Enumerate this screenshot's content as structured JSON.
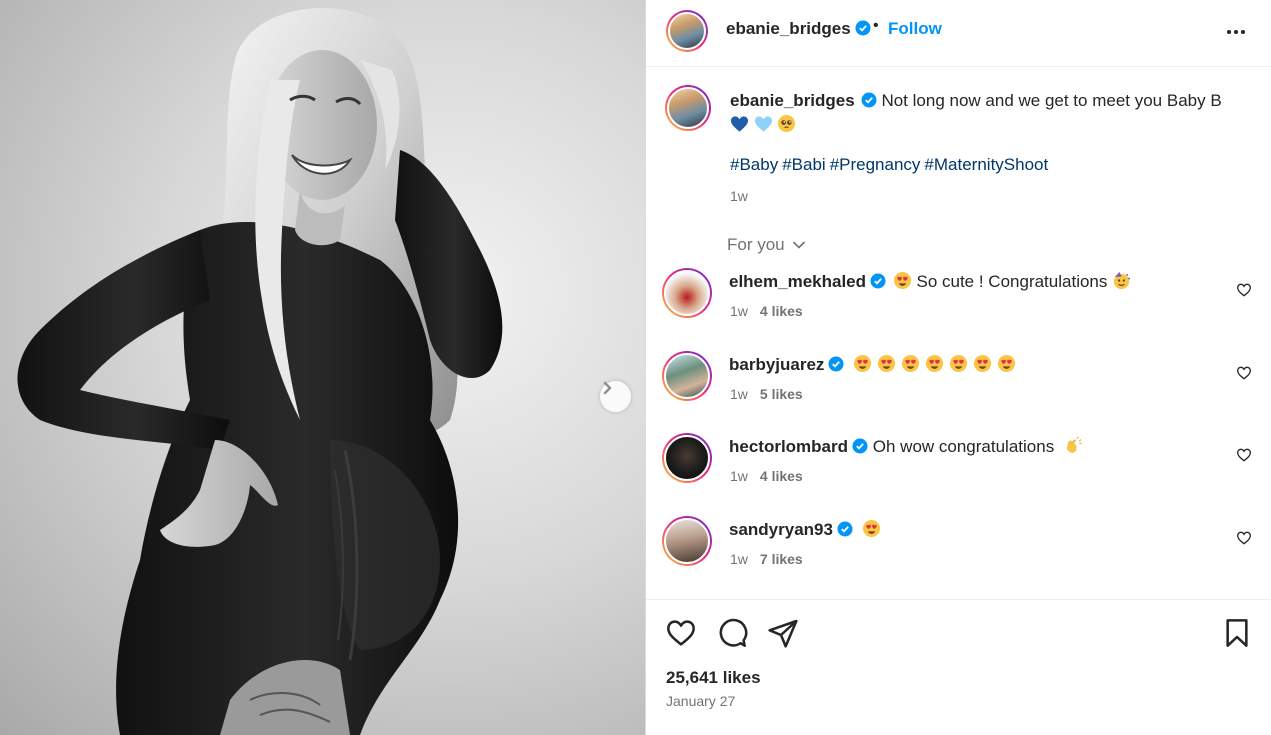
{
  "header": {
    "username": "ebanie_bridges",
    "separator": "•",
    "follow_label": "Follow"
  },
  "caption": {
    "username": "ebanie_bridges",
    "text": "Not long now and we get to meet you Baby B",
    "emojis": [
      "blue-heart",
      "light-blue-heart",
      "pleading-face"
    ],
    "hashtags": [
      "#Baby",
      "#Babi",
      "#Pregnancy",
      "#MaternityShoot"
    ],
    "time": "1w"
  },
  "sort": {
    "label": "For you"
  },
  "comments": [
    {
      "username": "elhem_mekhaled",
      "text": "So cute ! Congratulations",
      "time": "1w",
      "likes": "4 likes"
    },
    {
      "username": "barbyjuarez",
      "text": "",
      "time": "1w",
      "likes": "5 likes"
    },
    {
      "username": "hectorlombard",
      "text": "Oh wow congratulations",
      "time": "1w",
      "likes": "4 likes"
    },
    {
      "username": "sandyryan93",
      "text": "",
      "time": "1w",
      "likes": "7 likes"
    }
  ],
  "post": {
    "likes": "25,641 likes",
    "date": "January 27"
  },
  "colors": {
    "link_blue": "#0095f6",
    "hashtag_blue": "#00376b",
    "muted": "#737373",
    "text": "#262626"
  }
}
